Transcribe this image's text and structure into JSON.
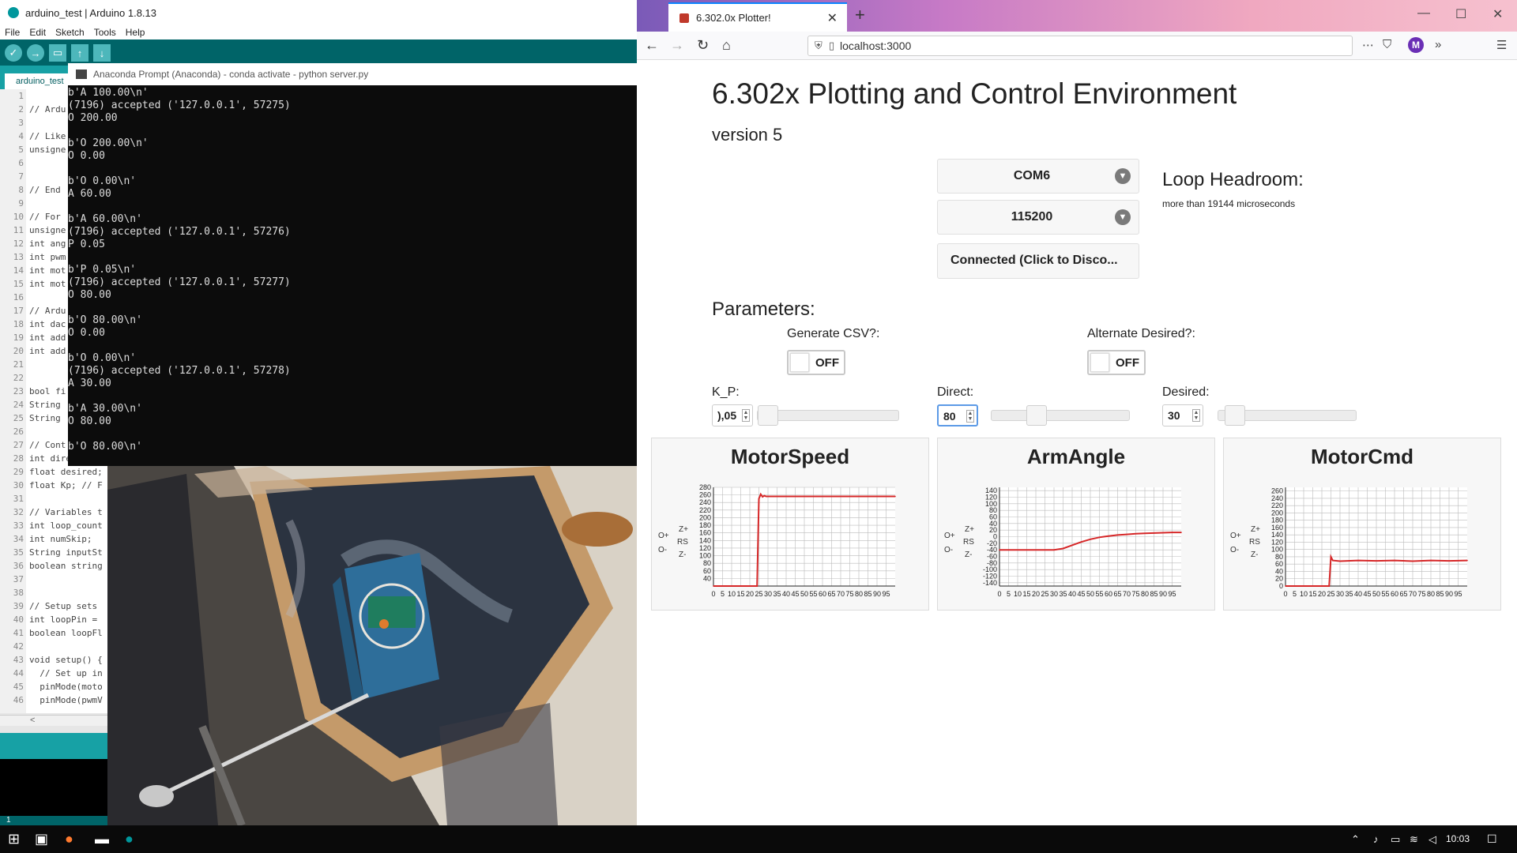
{
  "arduino": {
    "title": "arduino_test | Arduino 1.8.13",
    "menu": [
      "File",
      "Edit",
      "Sketch",
      "Tools",
      "Help"
    ],
    "tab": "arduino_test",
    "line_numbers": [
      "1",
      "2",
      "3",
      "4",
      "5",
      "6",
      "7",
      "8",
      "9",
      "10",
      "11",
      "12",
      "13",
      "14",
      "15",
      "16",
      "17",
      "18",
      "19",
      "20",
      "21",
      "22",
      "23",
      "24",
      "25",
      "26",
      "27",
      "28",
      "29",
      "30",
      "31",
      "32",
      "33",
      "34",
      "35",
      "36",
      "37",
      "38",
      "39",
      "40",
      "41",
      "42",
      "43",
      "44",
      "45",
      "46"
    ],
    "code": [
      "",
      "// Ardu",
      "",
      "// Like",
      "unsigne",
      "",
      "",
      "// End",
      "",
      "// For",
      "unsigne",
      "int ang",
      "int pwm",
      "int mot",
      "int mot",
      "",
      "// Ardu",
      "int dac",
      "int add",
      "int add",
      "",
      "",
      "bool fi",
      "String",
      "String",
      "",
      "// Cont",
      "int direct; // Direct motor command from host.",
      "float desired;",
      "float Kp; // F",
      "",
      "// Variables t",
      "int loop_count",
      "int numSkip;",
      "String inputSt",
      "boolean string",
      "",
      "",
      "// Setup sets",
      "int loopPin =",
      "boolean loopFl",
      "",
      "void setup() {",
      "  // Set up in",
      "  pinMode(moto",
      "  pinMode(pwmV"
    ],
    "scroll_left": "<",
    "status_line": "1"
  },
  "conda": {
    "title": "Anaconda Prompt (Anaconda) - conda  activate - python  server.py",
    "lines": [
      "b'A 100.00\\n'",
      "(7196) accepted ('127.0.0.1', 57275)",
      "O 200.00",
      "",
      "b'O 200.00\\n'",
      "O 0.00",
      "",
      "b'O 0.00\\n'",
      "A 60.00",
      "",
      "b'A 60.00\\n'",
      "(7196) accepted ('127.0.0.1', 57276)",
      "P 0.05",
      "",
      "b'P 0.05\\n'",
      "(7196) accepted ('127.0.0.1', 57277)",
      "O 80.00",
      "",
      "b'O 80.00\\n'",
      "O 0.00",
      "",
      "b'O 0.00\\n'",
      "(7196) accepted ('127.0.0.1', 57278)",
      "A 30.00",
      "",
      "b'A 30.00\\n'",
      "O 80.00",
      "",
      "b'O 80.00\\n'"
    ]
  },
  "browser": {
    "tab_title": "6.302.0x Plotter!",
    "url": "localhost:3000",
    "avatar": "M"
  },
  "app": {
    "title": "6.302x Plotting and Control Environment",
    "version": "version 5",
    "port": "COM6",
    "baud": "115200",
    "connect_label": "Connected (Click to Disco...",
    "headroom_title": "Loop Headroom:",
    "headroom_value": "more than 19144 microseconds",
    "params_title": "Parameters:",
    "csv_label": "Generate CSV?:",
    "csv_state": "OFF",
    "alt_label": "Alternate Desired?:",
    "alt_state": "OFF",
    "kp_label": "K_P:",
    "kp_value": "),05",
    "kp_level": 0.0,
    "direct_label": "Direct:",
    "direct_value": "80",
    "direct_level": 0.29,
    "desired_label": "Desired:",
    "desired_value": "30",
    "desired_level": 0.05,
    "plot_buttons": [
      "O+",
      "O-",
      "Z+",
      "RS",
      "Z-"
    ]
  },
  "colors": {
    "trace": "#d62728",
    "grid": "#bbbbbb"
  },
  "chart_data": [
    {
      "type": "line",
      "title": "MotorSpeed",
      "x_ticks": [
        "0",
        "5",
        "10",
        "15",
        "20",
        "25",
        "30",
        "35",
        "40",
        "45",
        "50",
        "55",
        "60",
        "65",
        "70",
        "75",
        "80",
        "85",
        "90",
        "95"
      ],
      "y_ticks": [
        "280",
        "260",
        "240",
        "220",
        "200",
        "180",
        "160",
        "140",
        "120",
        "100",
        "80",
        "60",
        "40"
      ],
      "ylim": [
        20,
        280
      ],
      "xlim": [
        0,
        100
      ],
      "x": [
        0,
        24,
        25,
        26,
        27,
        28,
        29,
        30,
        35,
        100
      ],
      "y": [
        20,
        20,
        250,
        262,
        255,
        258,
        256,
        256,
        256,
        256
      ]
    },
    {
      "type": "line",
      "title": "ArmAngle",
      "x_ticks": [
        "0",
        "5",
        "10",
        "15",
        "20",
        "25",
        "30",
        "35",
        "40",
        "45",
        "50",
        "55",
        "60",
        "65",
        "70",
        "75",
        "80",
        "85",
        "90",
        "95"
      ],
      "y_ticks": [
        "140",
        "120",
        "100",
        "80",
        "60",
        "40",
        "20",
        "0",
        "-20",
        "-40",
        "-60",
        "-80",
        "-100",
        "-120",
        "-140"
      ],
      "ylim": [
        -150,
        150
      ],
      "xlim": [
        0,
        100
      ],
      "x": [
        0,
        30,
        35,
        40,
        45,
        50,
        55,
        60,
        65,
        70,
        75,
        80,
        85,
        90,
        95,
        100
      ],
      "y": [
        -40,
        -40,
        -36,
        -26,
        -16,
        -8,
        -2,
        2,
        5,
        7,
        9,
        10,
        11,
        12,
        13,
        13
      ]
    },
    {
      "type": "line",
      "title": "MotorCmd",
      "x_ticks": [
        "0",
        "5",
        "10",
        "15",
        "20",
        "25",
        "30",
        "35",
        "40",
        "45",
        "50",
        "55",
        "60",
        "65",
        "70",
        "75",
        "80",
        "85",
        "90",
        "95"
      ],
      "y_ticks": [
        "260",
        "240",
        "220",
        "200",
        "180",
        "160",
        "140",
        "120",
        "100",
        "80",
        "60",
        "40",
        "20",
        "0"
      ],
      "ylim": [
        0,
        270
      ],
      "xlim": [
        0,
        100
      ],
      "x": [
        0,
        24,
        25,
        26,
        30,
        40,
        50,
        60,
        70,
        80,
        90,
        100
      ],
      "y": [
        0,
        0,
        80,
        70,
        68,
        70,
        69,
        70,
        68,
        70,
        69,
        70
      ]
    }
  ],
  "taskbar": {
    "time": "10:03"
  }
}
